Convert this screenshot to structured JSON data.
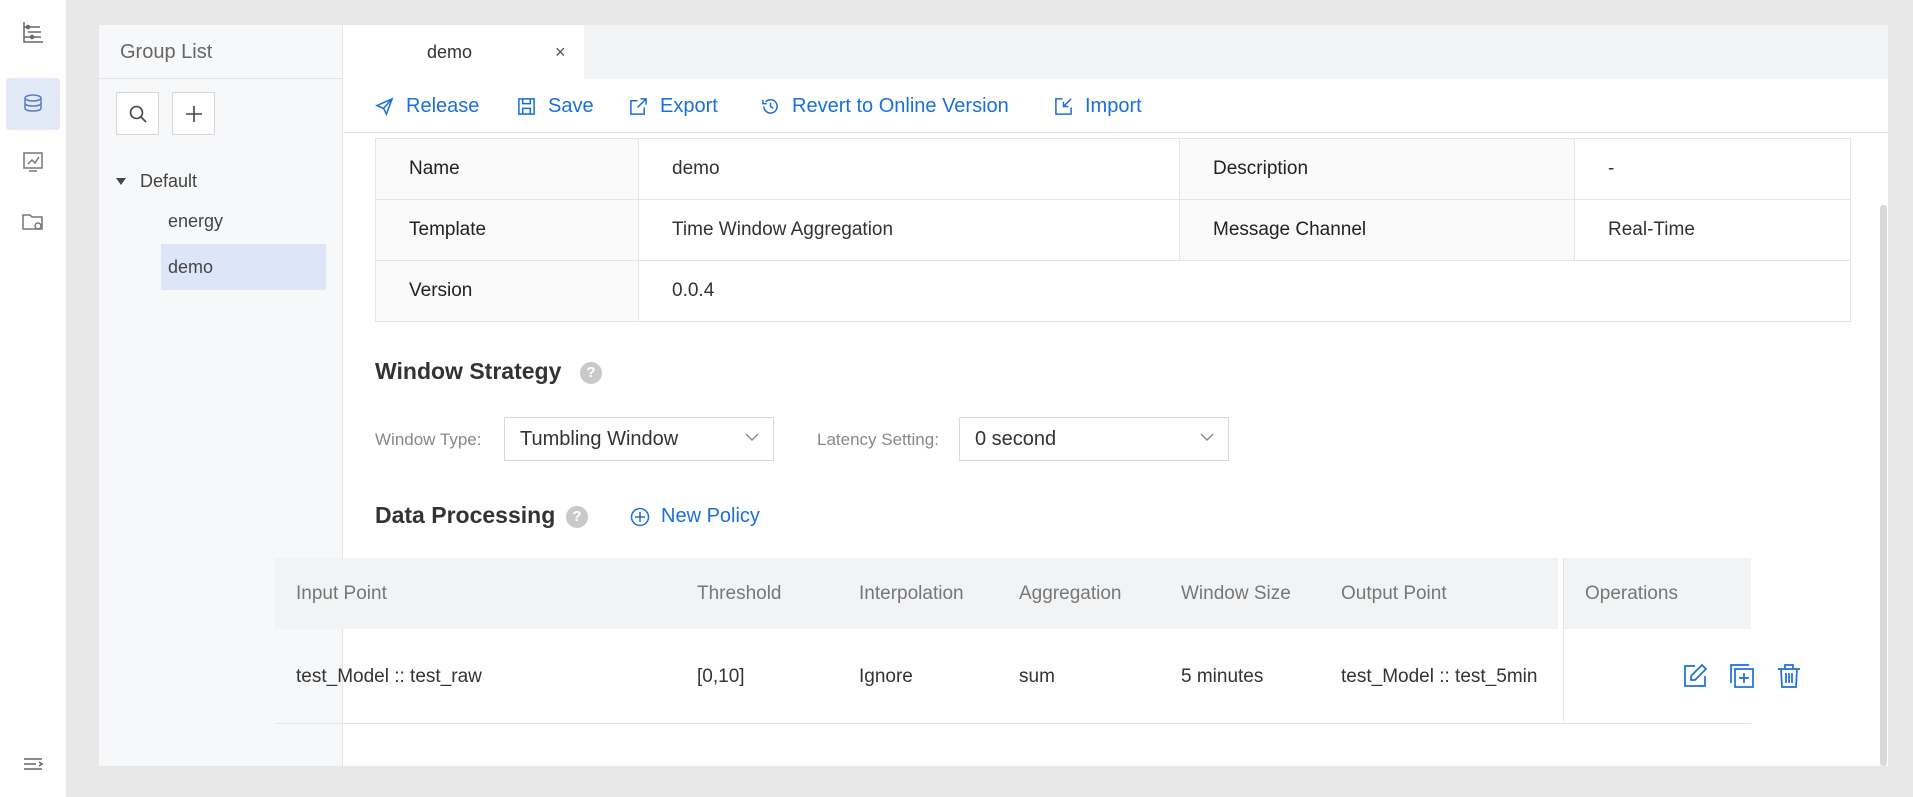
{
  "rail": {
    "items": [
      "flow-chart-icon",
      "layers-icon",
      "monitor-chart-icon",
      "folder-settings-icon"
    ],
    "bottom": "menu-collapse-icon"
  },
  "group_panel": {
    "title": "Group List",
    "tree": {
      "root_label": "Default",
      "items": [
        {
          "label": "energy",
          "selected": false
        },
        {
          "label": "demo",
          "selected": true
        }
      ]
    }
  },
  "tabs": [
    {
      "label": "demo",
      "close": "×"
    }
  ],
  "toolbar": {
    "release": "Release",
    "save": "Save",
    "export": "Export",
    "revert": "Revert to Online Version",
    "import": "Import"
  },
  "info": {
    "name_label": "Name",
    "name_value": "demo",
    "description_label": "Description",
    "description_value": "-",
    "template_label": "Template",
    "template_value": "Time Window Aggregation",
    "channel_label": "Message Channel",
    "channel_value": "Real-Time",
    "version_label": "Version",
    "version_value": "0.0.4"
  },
  "window_strategy": {
    "title": "Window Strategy",
    "help": "?",
    "window_type_label": "Window Type:",
    "window_type_value": "Tumbling Window",
    "latency_label": "Latency Setting:",
    "latency_value": "0 second"
  },
  "data_processing": {
    "title": "Data Processing",
    "help": "?",
    "new_policy": "New Policy",
    "columns": [
      "Input Point",
      "Threshold",
      "Interpolation",
      "Aggregation",
      "Window Size",
      "Output Point",
      "Operations"
    ],
    "rows": [
      [
        "test_Model :: test_raw",
        "[0,10]",
        "Ignore",
        "sum",
        "5 minutes",
        "test_Model :: test_5min"
      ]
    ]
  },
  "colors": {
    "accent": "#1b6fdb",
    "selected_bg": "#dce6f8",
    "header_bg": "#f2f3f5"
  }
}
